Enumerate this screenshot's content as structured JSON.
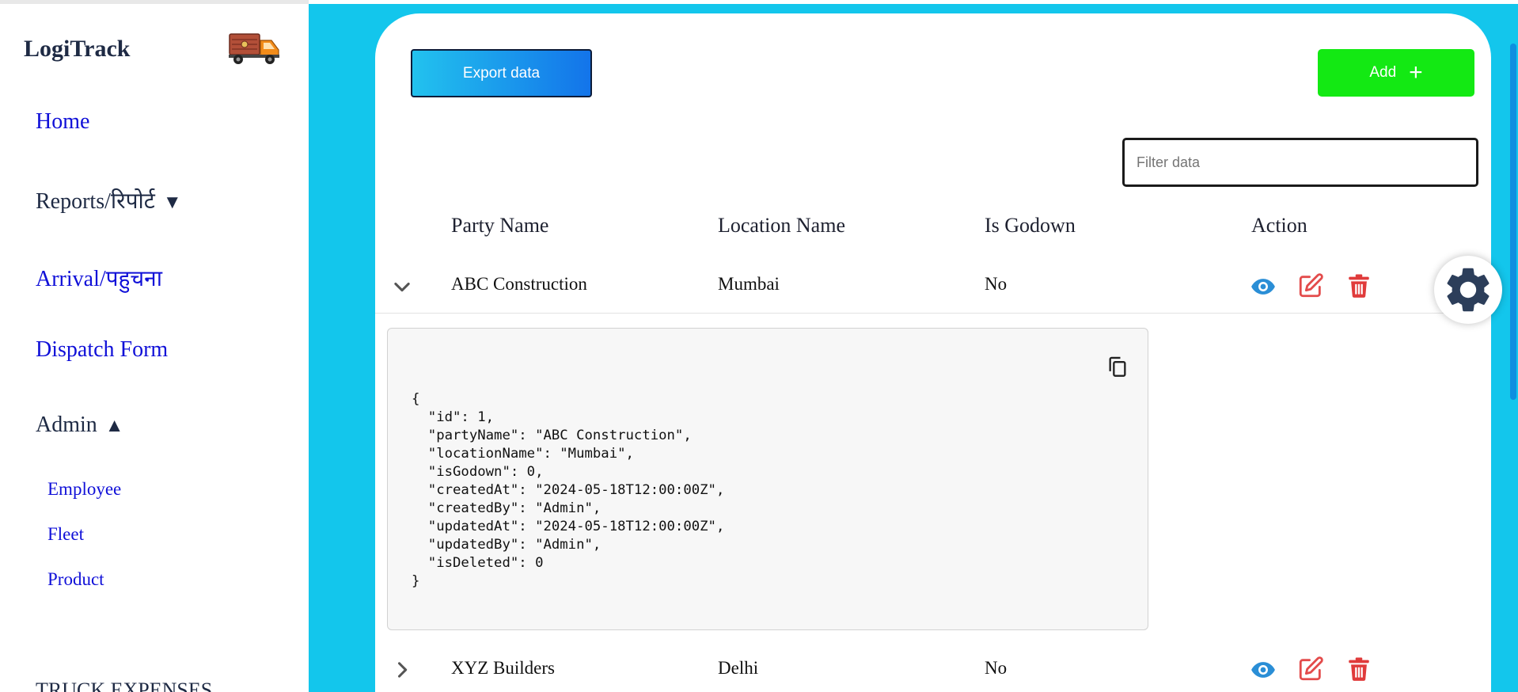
{
  "app": {
    "title": "LogiTrack"
  },
  "sidebar": {
    "home": "Home",
    "reports": "Reports/रिपोर्ट",
    "reports_arrow": "▼",
    "arrival": "Arrival/पहुचना",
    "dispatch": "Dispatch Form",
    "admin": "Admin",
    "admin_arrow": "▲",
    "sub_items": [
      "Employee",
      "Fleet",
      "Product"
    ],
    "truck_expenses": "TRUCK EXPENSES"
  },
  "toolbar": {
    "export_label": "Export data",
    "add_label": "Add"
  },
  "filter": {
    "placeholder": "Filter data",
    "value": ""
  },
  "table": {
    "headers": [
      "Party Name",
      "Location Name",
      "Is Godown",
      "Action"
    ],
    "rows": [
      {
        "party": "ABC Construction",
        "location": "Mumbai",
        "godown": "No",
        "expanded": true
      },
      {
        "party": "XYZ Builders",
        "location": "Delhi",
        "godown": "No",
        "expanded": false
      }
    ]
  },
  "expanded_json": "{\n  \"id\": 1,\n  \"partyName\": \"ABC Construction\",\n  \"locationName\": \"Mumbai\",\n  \"isGodown\": 0,\n  \"createdAt\": \"2024-05-18T12:00:00Z\",\n  \"createdBy\": \"Admin\",\n  \"updatedAt\": \"2024-05-18T12:00:00Z\",\n  \"updatedBy\": \"Admin\",\n  \"isDeleted\": 0\n}",
  "icons": {
    "truck": "truck-icon",
    "view": "eye-icon",
    "edit": "edit-icon",
    "delete": "trash-icon",
    "copy": "copy-icon",
    "settings": "gear-icon",
    "expand": "chevron-down-icon",
    "collapse": "chevron-right-icon"
  },
  "colors": {
    "background": "#13c6ec",
    "link": "#1010d8",
    "add_button": "#13e913",
    "view_icon": "#2a8ed6",
    "edit_icon": "#e34b4b",
    "delete_icon": "#e03b3b",
    "gear": "#2c3e5a"
  }
}
